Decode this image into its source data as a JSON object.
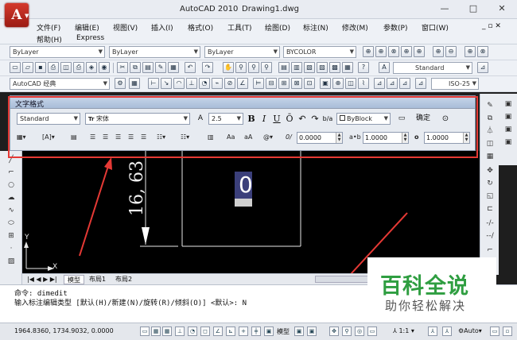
{
  "window": {
    "app_name": "AutoCAD 2010",
    "document": "Drawing1.dwg",
    "logo_letter": "A",
    "minimize": "—",
    "maximize": "□",
    "close": "✕"
  },
  "menu": {
    "row1": [
      "文件(F)",
      "编辑(E)",
      "视图(V)",
      "插入(I)",
      "格式(O)",
      "工具(T)",
      "绘图(D)",
      "标注(N)",
      "修改(M)",
      "参数(P)",
      "窗口(W)"
    ],
    "row2": [
      "帮助(H)",
      "Express"
    ],
    "doc_controls": "_ ▫ ✕"
  },
  "toolbars": {
    "layer_combo": "ByLayer",
    "linetype_combo": "ByLayer",
    "lineweight_combo": "ByLayer",
    "color_combo": "BYCOLOR",
    "workspace_combo": "AutoCAD 经典",
    "style_combo": "Standard",
    "iso_combo": "ISO-25"
  },
  "text_format": {
    "title": "文字格式",
    "style": "Standard",
    "font": "宋体",
    "font_prefix": "Tr",
    "height": "2.5",
    "bold": "B",
    "italic": "I",
    "underline": "U",
    "overline": "Ō",
    "color": "ByBlock",
    "ok": "确定",
    "case_upper": "Aa",
    "case_lower": "aA",
    "symbol": "@",
    "oblique": "0.0000",
    "tracking": "1.0000",
    "width_factor": "1.0000"
  },
  "drawing": {
    "dimension_text": "16, 63",
    "edit_char": "0",
    "ucs_y": "Y",
    "ucs_x": "X"
  },
  "layout_tabs": {
    "model": "模型",
    "layout1": "布局1",
    "layout2": "布局2"
  },
  "command": {
    "line1": "命令: dimedit",
    "line2": "输入标注编辑类型 [默认(H)/新建(N)/旋转(R)/倾斜(O)] <默认>: N"
  },
  "status": {
    "coordinates": "1964.8360, 1734.9032, 0.0000",
    "model_label": "模型",
    "scale": "1:1",
    "auto": "Auto"
  },
  "watermark": {
    "line1": "百科全说",
    "line2": "助你轻松解决"
  },
  "colors": {
    "highlight_red": "#e53935",
    "watermark_green": "#2f9e41",
    "canvas_black": "#000000"
  }
}
